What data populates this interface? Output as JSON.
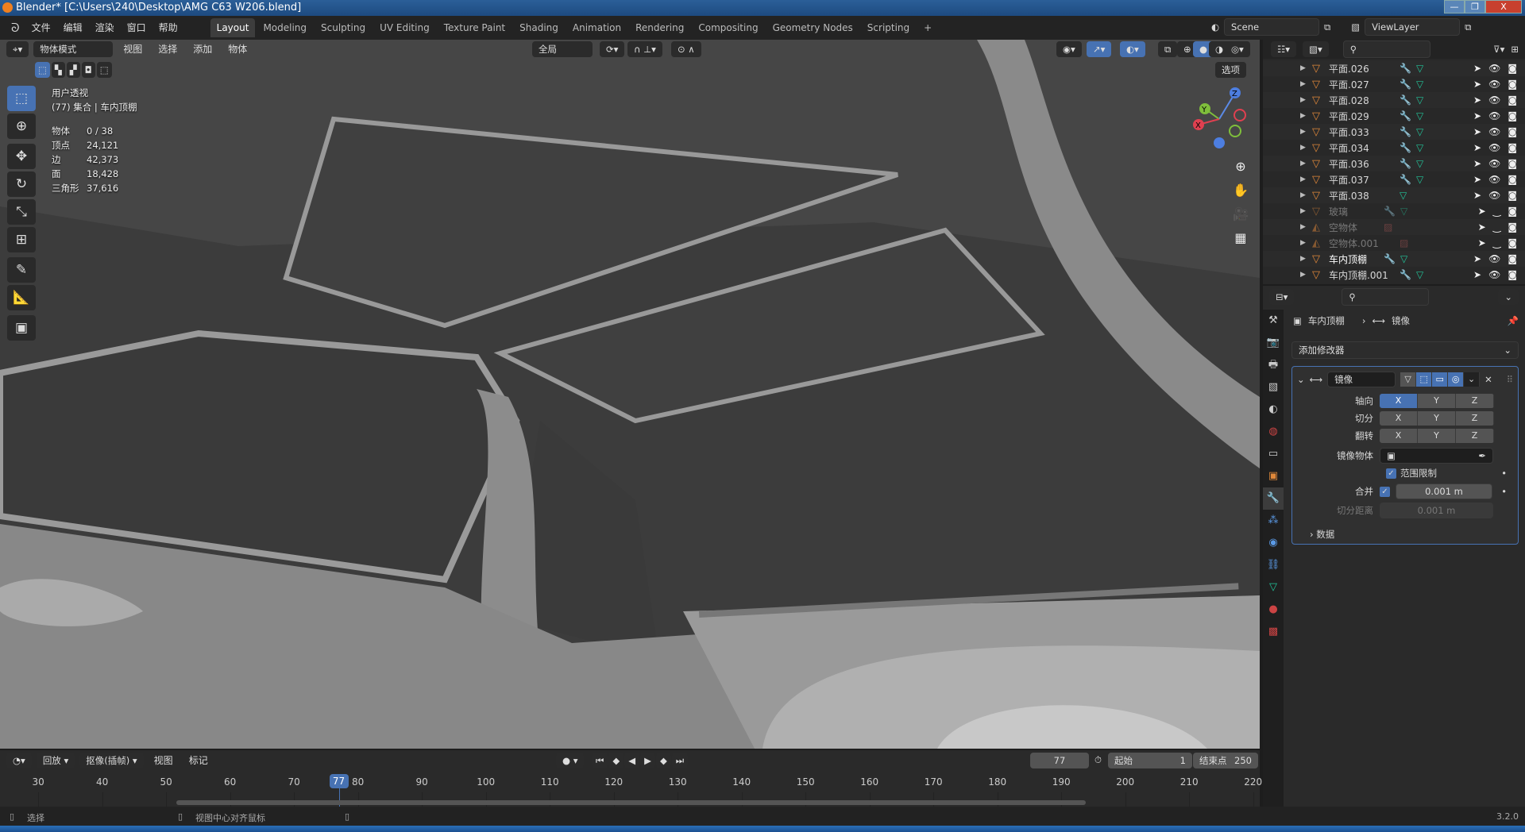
{
  "window": {
    "title": "Blender* [C:\\Users\\240\\Desktop\\AMG C63 W206.blend]",
    "min": "—",
    "max": "❐",
    "close": "X"
  },
  "menu": [
    "文件",
    "编辑",
    "渲染",
    "窗口",
    "帮助"
  ],
  "workspaces": [
    "Layout",
    "Modeling",
    "Sculpting",
    "UV Editing",
    "Texture Paint",
    "Shading",
    "Animation",
    "Rendering",
    "Compositing",
    "Geometry Nodes",
    "Scripting",
    "+"
  ],
  "scene": {
    "name": "Scene",
    "view_layer": "ViewLayer"
  },
  "viewport_header": {
    "mode": "物体模式",
    "menus": [
      "视图",
      "选择",
      "添加",
      "物体"
    ],
    "transform_orientation": "全局",
    "options": "选项"
  },
  "overlay": {
    "view": "用户透视",
    "collection": "(77) 集合 | 车内顶棚",
    "stats": [
      {
        "label": "物体",
        "value": "0 / 38"
      },
      {
        "label": "顶点",
        "value": "24,121"
      },
      {
        "label": "边",
        "value": "42,373"
      },
      {
        "label": "面",
        "value": "18,428"
      },
      {
        "label": "三角形",
        "value": "37,616"
      }
    ]
  },
  "gizmo": {
    "x": "X",
    "y": "Y",
    "z": "Z"
  },
  "outliner": {
    "items": [
      {
        "name": "平面.026",
        "type": "mesh",
        "modifier": true,
        "visible": true
      },
      {
        "name": "平面.027",
        "type": "mesh",
        "modifier": true,
        "visible": true
      },
      {
        "name": "平面.028",
        "type": "mesh",
        "modifier": true,
        "visible": true
      },
      {
        "name": "平面.029",
        "type": "mesh",
        "modifier": true,
        "visible": true
      },
      {
        "name": "平面.033",
        "type": "mesh",
        "modifier": true,
        "visible": true
      },
      {
        "name": "平面.034",
        "type": "mesh",
        "modifier": true,
        "visible": true
      },
      {
        "name": "平面.036",
        "type": "mesh",
        "modifier": true,
        "visible": true
      },
      {
        "name": "平面.037",
        "type": "mesh",
        "modifier": true,
        "visible": true
      },
      {
        "name": "平面.038",
        "type": "mesh",
        "modifier": false,
        "visible": true
      },
      {
        "name": "玻璃",
        "type": "mesh",
        "modifier": true,
        "visible": false
      },
      {
        "name": "空物体",
        "type": "empty",
        "modifier": false,
        "visible": false
      },
      {
        "name": "空物体.001",
        "type": "empty",
        "modifier": false,
        "visible": false
      },
      {
        "name": "车内顶棚",
        "type": "mesh",
        "modifier": true,
        "visible": true,
        "active": true
      },
      {
        "name": "车内顶棚.001",
        "type": "mesh",
        "modifier": true,
        "visible": true
      }
    ]
  },
  "properties": {
    "breadcrumb": {
      "object": "车内顶棚",
      "modifier": "镜像"
    },
    "add_modifier": "添加修改器",
    "modifier": {
      "name": "镜像",
      "rows": [
        {
          "label": "轴向",
          "active": "X"
        },
        {
          "label": "切分",
          "active": ""
        },
        {
          "label": "翻转",
          "active": ""
        }
      ],
      "axes": [
        "X",
        "Y",
        "Z"
      ],
      "mirror_object_label": "镜像物体",
      "clipping_label": "范围限制",
      "clipping": true,
      "merge_label": "合并",
      "merge": true,
      "merge_value": "0.001 m",
      "bisect_label": "切分距离",
      "bisect_value": "0.001 m",
      "data_label": "数据"
    }
  },
  "timeline": {
    "playback": "回放",
    "keying": "抠像(插帧)",
    "menus": [
      "视图",
      "标记"
    ],
    "current_frame": "77",
    "start_label": "起始",
    "start": "1",
    "end_label": "结束点",
    "end": "250",
    "ticks": [
      "30",
      "40",
      "50",
      "60",
      "70",
      "80",
      "90",
      "100",
      "110",
      "120",
      "130",
      "140",
      "150",
      "160",
      "170",
      "180",
      "190",
      "200",
      "210",
      "220"
    ]
  },
  "status": {
    "select": "选择",
    "center": "视图中心对齐鼠标",
    "version": "3.2.0"
  },
  "colors": {
    "accent": "#4772b3",
    "mesh_icon": "#e0883a",
    "modifier_icon": "#5b80d6",
    "mesh_data_icon": "#22c49a"
  }
}
